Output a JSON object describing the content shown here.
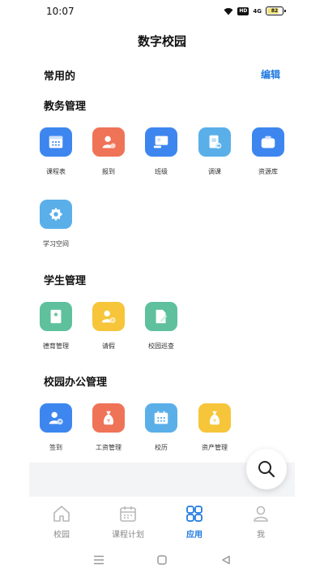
{
  "status_bar": {
    "time": "10:07",
    "hd": "HD",
    "signal": "4G",
    "battery": "82"
  },
  "header": {
    "title": "数字校园"
  },
  "common": {
    "label": "常用的",
    "edit": "编辑"
  },
  "sections": [
    {
      "title": "教务管理",
      "items": [
        {
          "label": "课程表",
          "icon": "calendar-icon",
          "color": "#3d86ef"
        },
        {
          "label": "报到",
          "icon": "user-check-icon",
          "color": "#ef7357"
        },
        {
          "label": "班级",
          "icon": "class-board-icon",
          "color": "#3d86ef"
        },
        {
          "label": "调课",
          "icon": "course-switch-icon",
          "color": "#5aafe9"
        },
        {
          "label": "资源库",
          "icon": "box-icon",
          "color": "#3d86ef"
        },
        {
          "label": "学习空间",
          "icon": "gear-icon",
          "color": "#5aafe9"
        }
      ]
    },
    {
      "title": "学生管理",
      "items": [
        {
          "label": "德育管理",
          "icon": "book-star-icon",
          "color": "#5fc09d"
        },
        {
          "label": "请假",
          "icon": "user-clock-icon",
          "color": "#f6c53a"
        },
        {
          "label": "校园巡查",
          "icon": "edit-doc-icon",
          "color": "#5fc09d"
        }
      ]
    },
    {
      "title": "校园办公管理",
      "items": [
        {
          "label": "签到",
          "icon": "user-clock-icon",
          "color": "#3d86ef"
        },
        {
          "label": "工资管理",
          "icon": "money-bag-icon",
          "color": "#ef7357"
        },
        {
          "label": "校历",
          "icon": "calendar-icon",
          "color": "#5aafe9"
        },
        {
          "label": "资产管理",
          "icon": "money-bag-icon",
          "color": "#f6c53a"
        }
      ]
    }
  ],
  "tabbar": {
    "items": [
      {
        "label": "校园",
        "icon": "home-icon"
      },
      {
        "label": "课程计划",
        "icon": "calendar-icon"
      },
      {
        "label": "应用",
        "icon": "apps-grid-icon",
        "active": true
      },
      {
        "label": "我",
        "icon": "person-icon"
      }
    ],
    "active_color": "#1f7ae0"
  },
  "search_fab": {
    "icon": "search-icon"
  },
  "system_nav": {
    "icons": [
      "menu-icon",
      "home-square-icon",
      "back-triangle-icon"
    ]
  }
}
